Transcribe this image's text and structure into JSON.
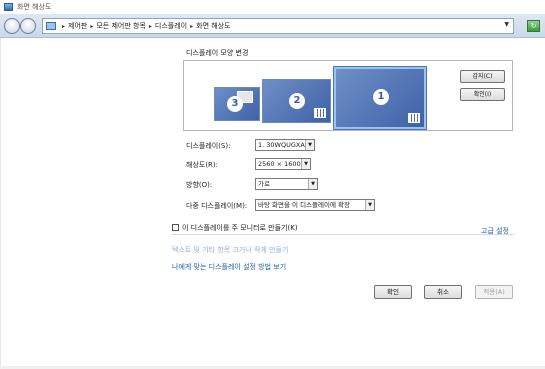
{
  "window": {
    "title": "화면 해상도"
  },
  "address": {
    "crumbs": [
      "제어판",
      "모든 제어판 항목",
      "디스플레이",
      "화면 해상도"
    ],
    "separator": "▸"
  },
  "heading": "디스플레이 모양 변경",
  "preview": {
    "monitors": [
      {
        "number": "1",
        "selected": true
      },
      {
        "number": "2",
        "selected": false
      },
      {
        "number": "3",
        "selected": false
      }
    ]
  },
  "side_buttons": {
    "detect": "감지(C)",
    "identify": "확인(I)"
  },
  "form": {
    "display": {
      "label": "디스플레이(S):",
      "value": "1. 30WQUGXA"
    },
    "resolution": {
      "label": "해상도(R):",
      "value": "2560 × 1600"
    },
    "orientation": {
      "label": "방향(O):",
      "value": "가로"
    },
    "multi": {
      "label": "다중 디스플레이(M):",
      "value": "바탕 화면을 이 디스플레이에 확장"
    }
  },
  "main_display_checkbox": {
    "label": "이 디스플레이를 주 모니터로 만들기(K)",
    "checked": false
  },
  "links": {
    "advanced": "고급 설정",
    "text_size": "텍스트 및 기타 항목 크거나 작게 만들기",
    "help": "나에게 맞는 디스플레이 설정 방법 보기"
  },
  "buttons": {
    "ok": "확인",
    "cancel": "취소",
    "apply": "적용(A)"
  },
  "colors": {
    "link": "#1c5fa8",
    "monitor": "#3f62a8",
    "address_bar": "#c9d8ea"
  },
  "icons": [
    "back-icon",
    "forward-icon",
    "monitor-icon",
    "dropdown-arrow-icon",
    "refresh-icon"
  ]
}
